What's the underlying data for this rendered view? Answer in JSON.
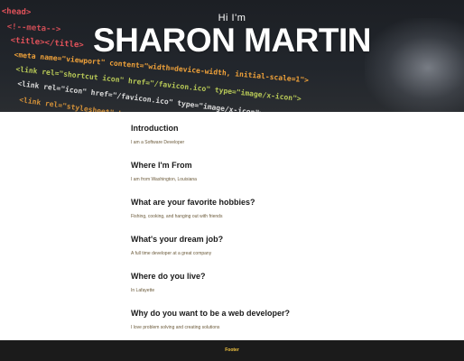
{
  "hero": {
    "greeting": "Hi I'm",
    "name": "SHARON MARTIN",
    "code_lines": [
      "<head>",
      "<!--meta-->",
      "<title></title>",
      "<meta name=\"viewport\" content=\"width=device-width, initial-scale=1\">",
      "<link rel=\"shortcut icon\" href=\"/favicon.ico\" type=\"image/x-icon\">",
      "<link rel=\"icon\" href=\"/favicon.ico\" type=\"image/x-icon\">",
      "<link rel=\"stylesheet\" href=\"css/materialize.min.css\" media=\"screen,projection\">"
    ],
    "code_colors": {
      "tag": "#e0525a",
      "attr": "#f0a23a",
      "string": "#b8c957",
      "plain": "#d9d9d9"
    }
  },
  "sections": [
    {
      "heading": "Introduction",
      "text": "I am a Software Developer"
    },
    {
      "heading": "Where I'm From",
      "text": "I am from Washington, Louisiana"
    },
    {
      "heading": "What are your favorite hobbies?",
      "text": "Fishing, cooking, and hanging out with friends"
    },
    {
      "heading": "What's your dream job?",
      "text": "A full time developer at a great company"
    },
    {
      "heading": "Where do you live?",
      "text": "In Lafayette"
    },
    {
      "heading": "Why do you want to be a web developer?",
      "text": "I love problem solving and creating solutions"
    }
  ],
  "footer": {
    "text": "Footer"
  },
  "colors": {
    "footer_bg": "#1b1b1b",
    "footer_text": "#f2c440",
    "body_text": "#6b5a3a",
    "heading_text": "#1a1a1a"
  }
}
